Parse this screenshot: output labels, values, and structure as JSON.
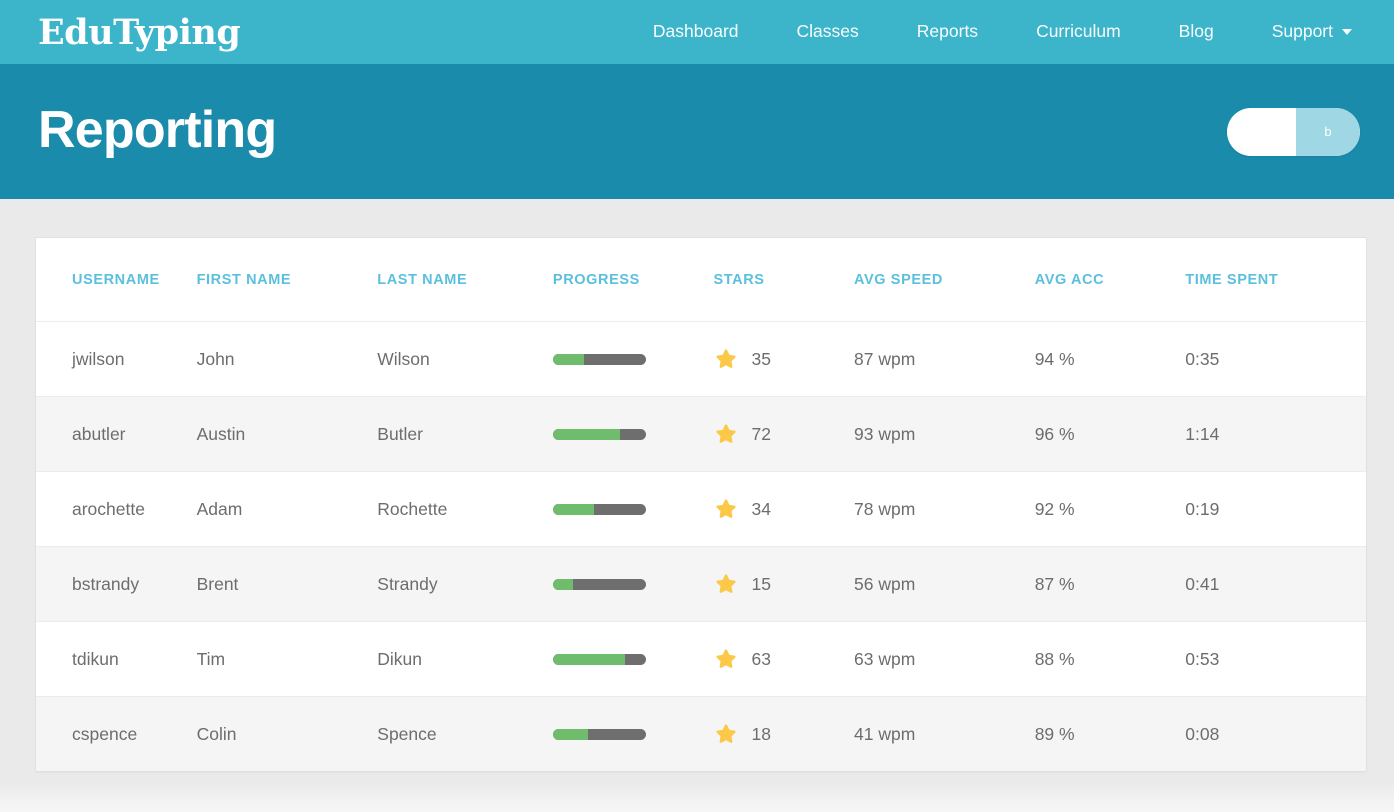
{
  "nav": {
    "brand": "EduTyping",
    "links": [
      {
        "label": "Dashboard"
      },
      {
        "label": "Classes"
      },
      {
        "label": "Reports"
      },
      {
        "label": "Curriculum"
      },
      {
        "label": "Blog"
      },
      {
        "label": "Support",
        "has_caret": true
      }
    ]
  },
  "header": {
    "title": "Reporting",
    "toggle": {
      "state": "off",
      "track_label": "b"
    }
  },
  "table": {
    "columns": [
      "USERNAME",
      "FIRST NAME",
      "LAST NAME",
      "PROGRESS",
      "STARS",
      "AVG SPEED",
      "AVG ACC",
      "TIME SPENT"
    ],
    "rows": [
      {
        "username": "jwilson",
        "first_name": "John",
        "last_name": "Wilson",
        "progress": 33,
        "stars": "35",
        "avg_speed": "87 wpm",
        "avg_acc": "94 %",
        "time_spent": "0:35"
      },
      {
        "username": "abutler",
        "first_name": "Austin",
        "last_name": "Butler",
        "progress": 72,
        "stars": "72",
        "avg_speed": "93 wpm",
        "avg_acc": "96 %",
        "time_spent": "1:14"
      },
      {
        "username": "arochette",
        "first_name": "Adam",
        "last_name": "Rochette",
        "progress": 44,
        "stars": "34",
        "avg_speed": "78 wpm",
        "avg_acc": "92 %",
        "time_spent": "0:19"
      },
      {
        "username": "bstrandy",
        "first_name": "Brent",
        "last_name": "Strandy",
        "progress": 22,
        "stars": "15",
        "avg_speed": "56 wpm",
        "avg_acc": "87 %",
        "time_spent": "0:41"
      },
      {
        "username": "tdikun",
        "first_name": "Tim",
        "last_name": "Dikun",
        "progress": 77,
        "stars": "63",
        "avg_speed": "63 wpm",
        "avg_acc": "88 %",
        "time_spent": "0:53"
      },
      {
        "username": "cspence",
        "first_name": "Colin",
        "last_name": "Spence",
        "progress": 38,
        "stars": "18",
        "avg_speed": "41 wpm",
        "avg_acc": "89 %",
        "time_spent": "0:08"
      }
    ]
  },
  "colors": {
    "nav_bg": "#3cb4ca",
    "header_bg": "#1a8bab",
    "page_bg": "#eaeaea",
    "column_header_text": "#5bc0dd",
    "progress_fill": "#6ebc6c",
    "progress_track": "#6e6e6e",
    "star": "#fbc848",
    "body_text": "#6d6d6d"
  }
}
